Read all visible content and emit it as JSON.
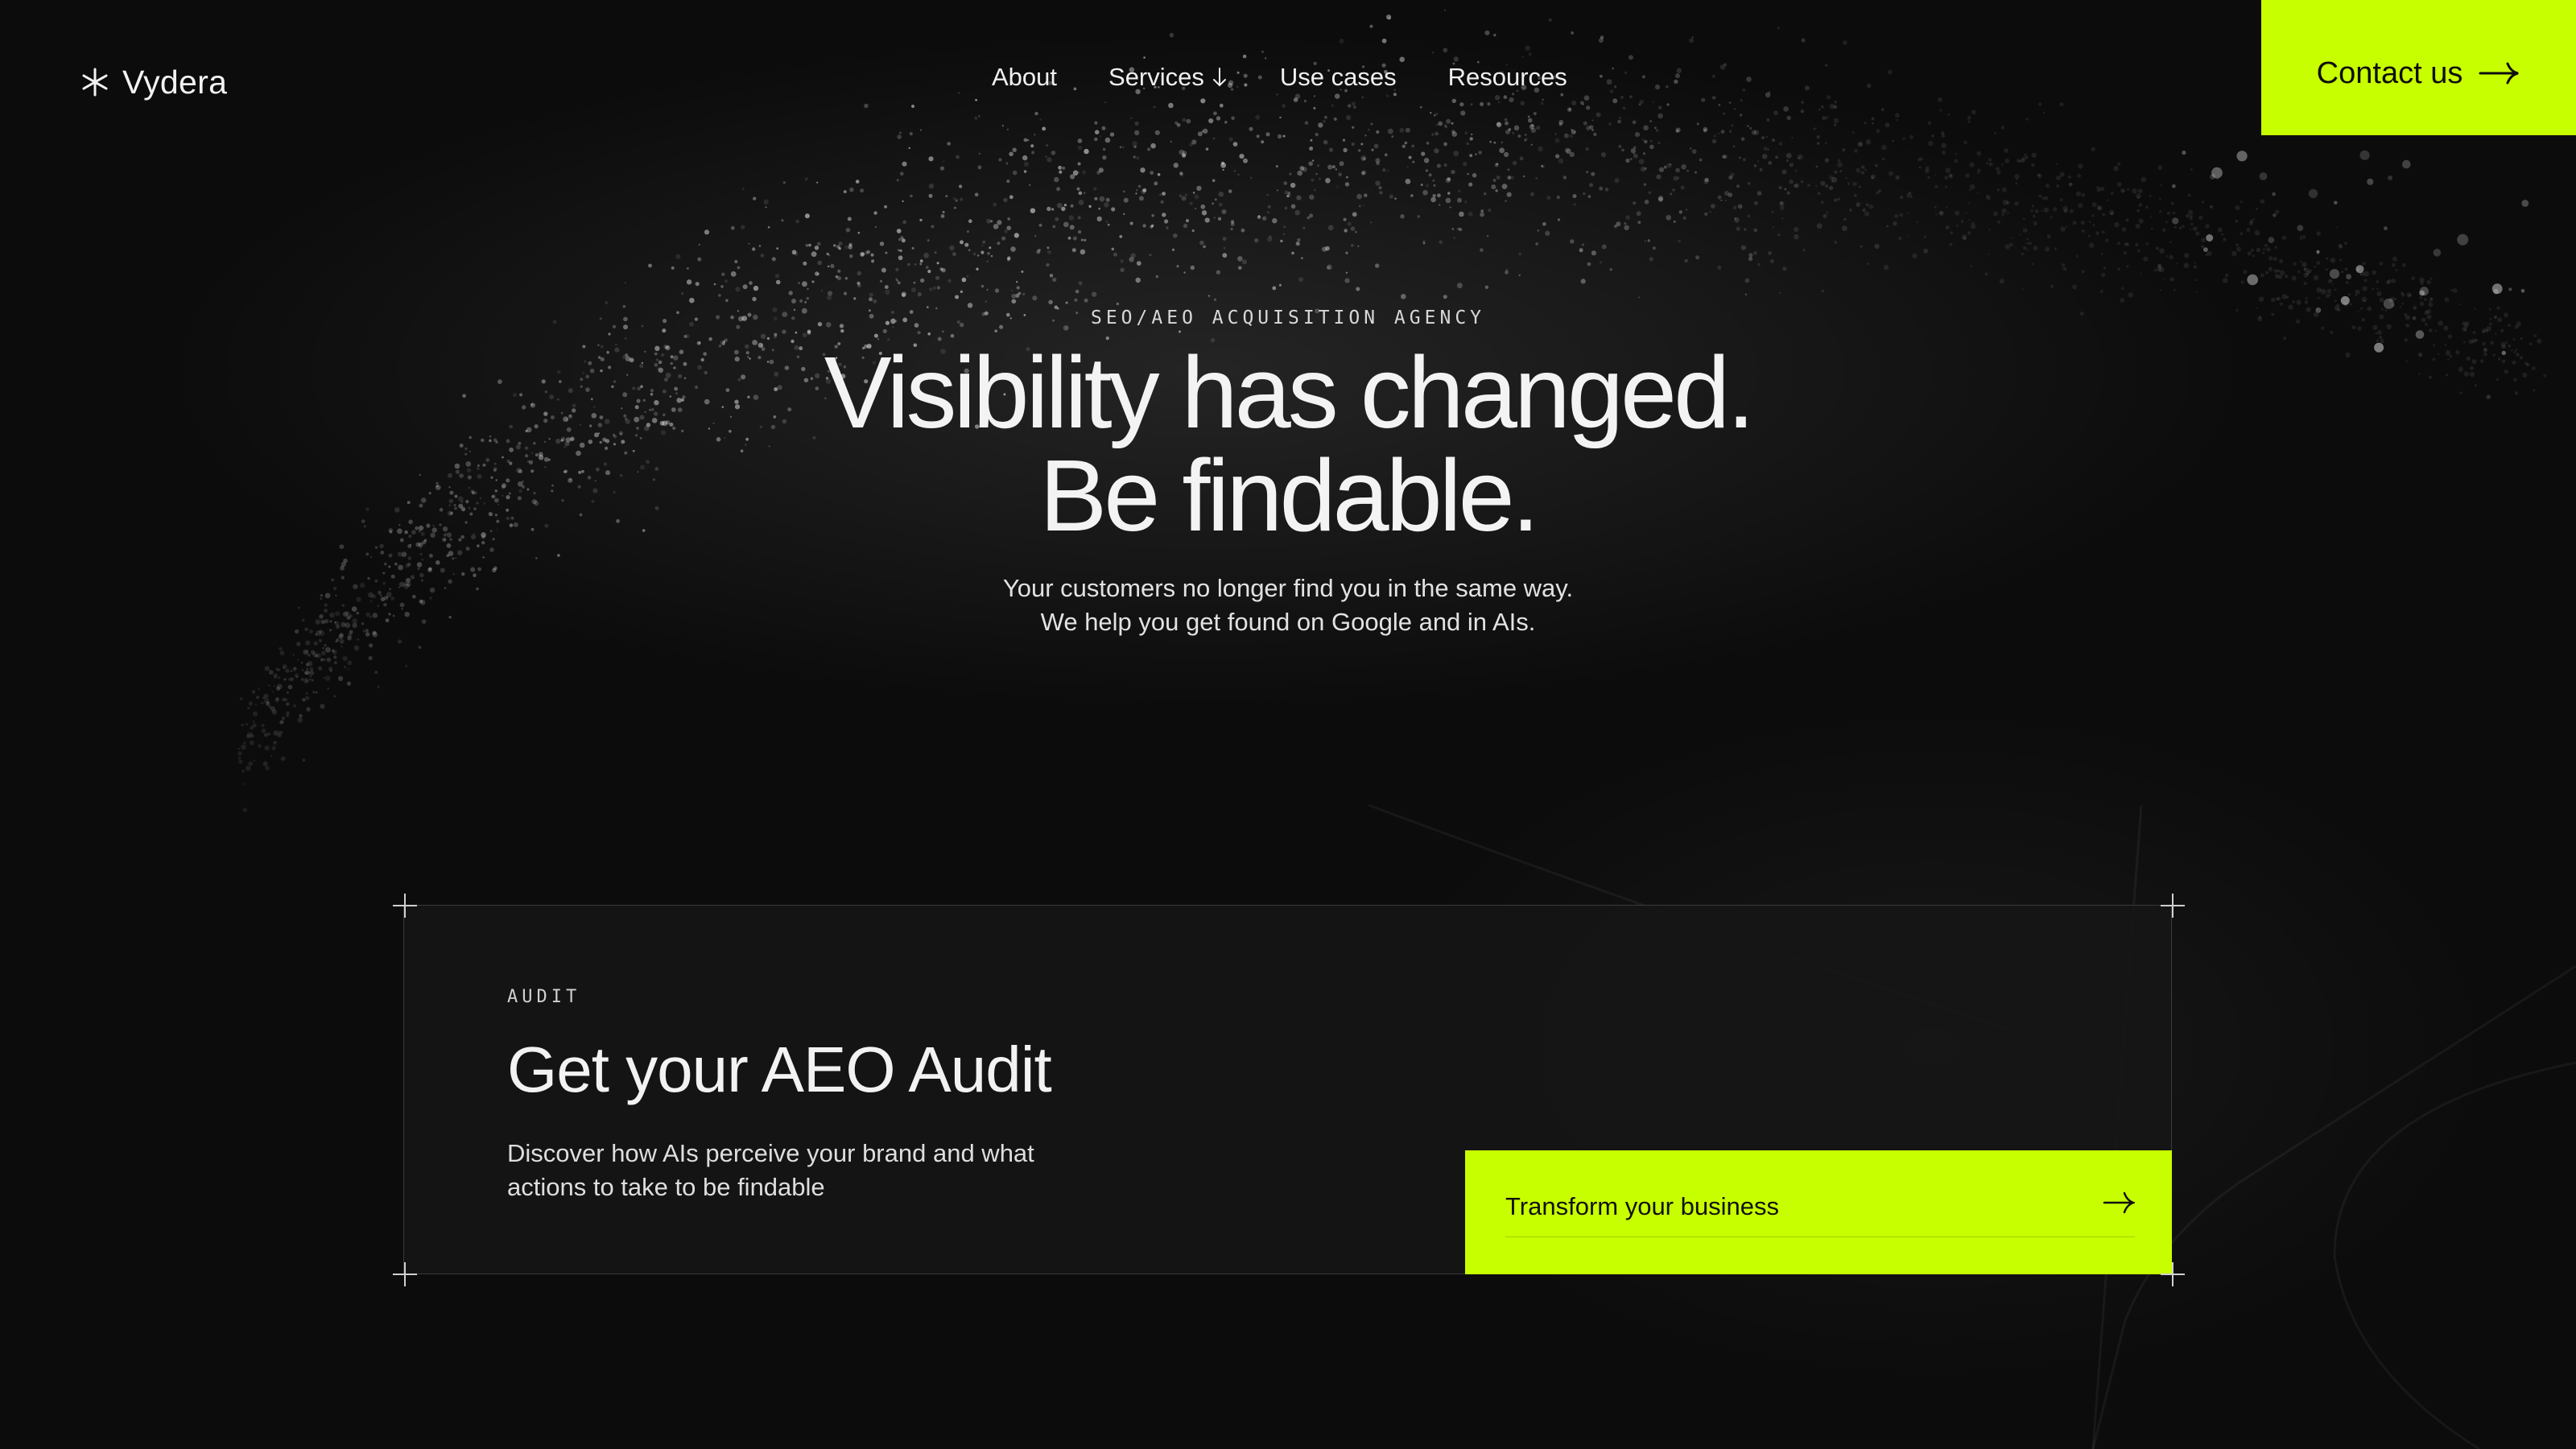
{
  "brand": {
    "name": "Vydera",
    "icon": "asterisk-icon"
  },
  "nav": {
    "items": [
      {
        "label": "About"
      },
      {
        "label": "Services",
        "icon": "arrow-down-icon"
      },
      {
        "label": "Use cases"
      },
      {
        "label": "Resources"
      }
    ],
    "contact_label": "Contact us",
    "contact_icon": "arrow-right-icon"
  },
  "hero": {
    "eyebrow": "SEO/AEO ACQUISITION AGENCY",
    "headline_line1": "Visibility has changed.",
    "headline_line2": "Be findable.",
    "sub_line1": "Your customers no longer find you in the same way.",
    "sub_line2": "We help you get found on Google and in AIs."
  },
  "audit": {
    "eyebrow": "AUDIT",
    "title": "Get your AEO Audit",
    "description": "Discover how AIs perceive your brand and what actions to take to be findable",
    "cta_label": "Transform your business",
    "cta_icon": "arrow-right-icon"
  },
  "colors": {
    "accent": "#c8ff00",
    "background": "#0c0c0c",
    "text": "#f2f2f2"
  }
}
